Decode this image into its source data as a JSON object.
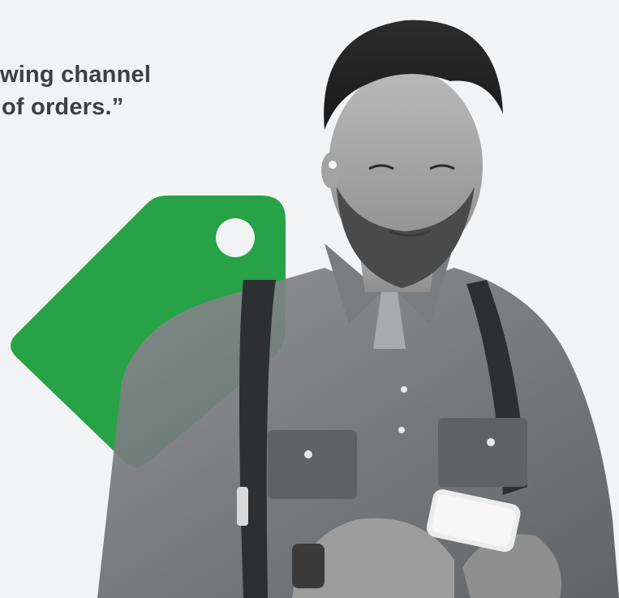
{
  "quote": {
    "line_1": "wing channel",
    "line_2": "of orders.”"
  },
  "graphics": {
    "tag_icon": "price-tag-icon",
    "tag_color": "#1e9e3e",
    "background_color": "#f1f3f4",
    "text_color": "#3c4043"
  }
}
